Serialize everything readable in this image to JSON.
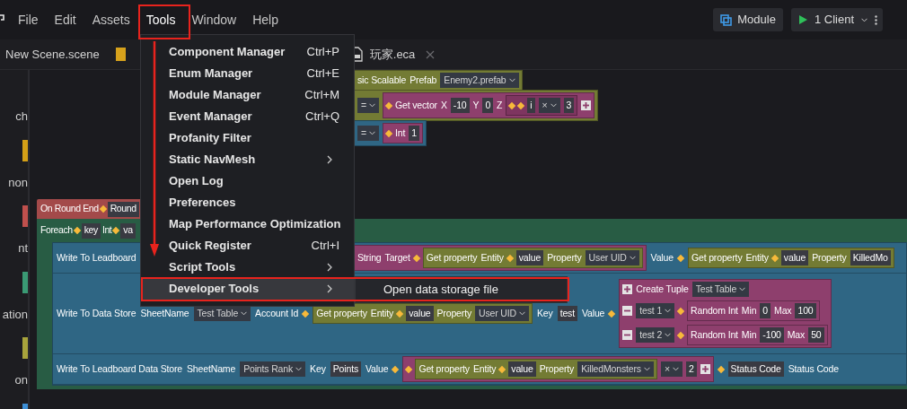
{
  "menubar": {
    "items": [
      {
        "label": "File",
        "selected": false
      },
      {
        "label": "Edit",
        "selected": false
      },
      {
        "label": "Assets",
        "selected": false
      },
      {
        "label": "Tools",
        "selected": true
      },
      {
        "label": "Window",
        "selected": false
      },
      {
        "label": "Help",
        "selected": false
      }
    ]
  },
  "toolbar": {
    "module_button": "Module",
    "run_button": "1 Client"
  },
  "tabs": [
    {
      "kind": "scene",
      "label": "New Scene.scene"
    },
    {
      "kind": "script",
      "label": "玩家.eca",
      "closable": true
    }
  ],
  "sidebar": {
    "items": [
      {
        "label": "ch"
      },
      {
        "color": "#d4a017",
        "label": "non"
      },
      {
        "color": "#c0504d",
        "label": "nt"
      },
      {
        "color": "#3a9a74",
        "label": "ation"
      },
      {
        "color": "#a8a43c",
        "label": "on"
      },
      {
        "color": "#3d8fd6"
      }
    ]
  },
  "canvas": {
    "blocks": [
      {
        "kind": "block",
        "color": "#737b34",
        "tokens": [
          {
            "kind": "text",
            "text": "sic Scalable"
          },
          {
            "kind": "text",
            "text": "Prefab"
          },
          {
            "kind": "dropdown",
            "text": "Enemy2.prefab"
          }
        ]
      },
      {
        "kind": "block",
        "color": "#737b34",
        "tokens": [
          {
            "kind": "dropdown",
            "text": "="
          },
          {
            "kind": "block",
            "color": "#8e3f6d",
            "tokens": [
              {
                "kind": "pin"
              },
              {
                "kind": "text",
                "text": "Get vector"
              },
              {
                "kind": "text",
                "text": "X"
              },
              {
                "kind": "field",
                "text": "-10"
              },
              {
                "kind": "text",
                "text": "Y"
              },
              {
                "kind": "field",
                "text": "0"
              },
              {
                "kind": "text",
                "text": "Z"
              },
              {
                "kind": "block",
                "color": "#7e3560",
                "tokens": [
                  {
                    "kind": "pin"
                  },
                  {
                    "kind": "pin"
                  },
                  {
                    "kind": "field",
                    "text": "i"
                  },
                  {
                    "kind": "dropdown",
                    "text": "×"
                  },
                  {
                    "kind": "field",
                    "text": "3"
                  }
                ]
              },
              {
                "kind": "plus"
              }
            ]
          }
        ]
      },
      {
        "kind": "block",
        "color": "#2f6684",
        "tokens": [
          {
            "kind": "dropdown",
            "text": "="
          },
          {
            "kind": "block",
            "color": "#8e3f6d",
            "tokens": [
              {
                "kind": "pin"
              },
              {
                "kind": "text",
                "text": "Int"
              },
              {
                "kind": "field",
                "text": "1"
              }
            ]
          }
        ]
      }
    ],
    "event": {
      "header": [
        {
          "kind": "text",
          "text": "On Round End"
        },
        {
          "kind": "pin"
        },
        {
          "kind": "field",
          "text": "Round"
        }
      ],
      "loop": [
        {
          "kind": "text",
          "text": "Foreach"
        },
        {
          "kind": "pin"
        },
        {
          "kind": "field",
          "text": "key"
        },
        {
          "kind": "text",
          "text": "Int"
        },
        {
          "kind": "pin"
        },
        {
          "kind": "field",
          "text": "va"
        }
      ],
      "statements": [
        {
          "tokens": [
            {
              "kind": "text",
              "text": "Write To Leadboard"
            }
          ],
          "tokens_right": [
            {
              "kind": "block",
              "color": "#8e3f6d",
              "tokens": [
                {
                  "kind": "text",
                  "text": "String"
                },
                {
                  "kind": "text",
                  "text": "Target"
                },
                {
                  "kind": "pin"
                },
                {
                  "kind": "block",
                  "color": "#737b34",
                  "tokens": [
                    {
                      "kind": "text",
                      "text": "Get property"
                    },
                    {
                      "kind": "text",
                      "text": "Entity"
                    },
                    {
                      "kind": "pin"
                    },
                    {
                      "kind": "field",
                      "text": "value"
                    },
                    {
                      "kind": "text",
                      "text": "Property"
                    },
                    {
                      "kind": "dropdown",
                      "text": "User UID"
                    }
                  ]
                }
              ]
            },
            {
              "kind": "text",
              "text": "Value"
            },
            {
              "kind": "pin"
            },
            {
              "kind": "block",
              "color": "#737b34",
              "tokens": [
                {
                  "kind": "text",
                  "text": "Get property"
                },
                {
                  "kind": "text",
                  "text": "Entity"
                },
                {
                  "kind": "pin"
                },
                {
                  "kind": "field",
                  "text": "value"
                },
                {
                  "kind": "text",
                  "text": "Property"
                },
                {
                  "kind": "field",
                  "text": "KilledMo"
                }
              ]
            }
          ]
        },
        {
          "tokens": [
            {
              "kind": "text",
              "text": "Write To Data Store"
            },
            {
              "kind": "text",
              "text": "SheetName"
            },
            {
              "kind": "dropdown",
              "text": "Test Table"
            },
            {
              "kind": "text",
              "text": "Account Id"
            },
            {
              "kind": "pin"
            },
            {
              "kind": "block",
              "color": "#737b34",
              "tokens": [
                {
                  "kind": "text",
                  "text": "Get property"
                },
                {
                  "kind": "text",
                  "text": "Entity"
                },
                {
                  "kind": "pin"
                },
                {
                  "kind": "field",
                  "text": "value"
                },
                {
                  "kind": "text",
                  "text": "Property"
                },
                {
                  "kind": "dropdown",
                  "text": "User UID"
                }
              ]
            },
            {
              "kind": "text",
              "text": "Key"
            },
            {
              "kind": "field",
              "text": "test"
            },
            {
              "kind": "text",
              "text": "Value"
            },
            {
              "kind": "pin"
            },
            {
              "kind": "block",
              "color": "#8e3f6d",
              "rows": [
                [
                  {
                    "kind": "plus"
                  },
                  {
                    "kind": "text",
                    "text": "Create Tuple"
                  },
                  {
                    "kind": "dropdown",
                    "text": "Test Table"
                  }
                ],
                [
                  {
                    "kind": "minus"
                  },
                  {
                    "kind": "dropdown",
                    "text": "test 1"
                  },
                  {
                    "kind": "pin"
                  },
                  {
                    "kind": "block",
                    "color": "#8e3f6d",
                    "tokens": [
                      {
                        "kind": "text",
                        "text": "Random Int"
                      },
                      {
                        "kind": "text",
                        "text": "Min"
                      },
                      {
                        "kind": "field",
                        "text": "0"
                      },
                      {
                        "kind": "text",
                        "text": "Max"
                      },
                      {
                        "kind": "field",
                        "text": "100"
                      }
                    ]
                  }
                ],
                [
                  {
                    "kind": "minus"
                  },
                  {
                    "kind": "dropdown",
                    "text": "test 2"
                  },
                  {
                    "kind": "pin"
                  },
                  {
                    "kind": "block",
                    "color": "#8e3f6d",
                    "tokens": [
                      {
                        "kind": "text",
                        "text": "Random Int"
                      },
                      {
                        "kind": "text",
                        "text": "Min"
                      },
                      {
                        "kind": "field",
                        "text": "-100"
                      },
                      {
                        "kind": "text",
                        "text": "Max"
                      },
                      {
                        "kind": "field",
                        "text": "50"
                      }
                    ]
                  }
                ]
              ]
            }
          ]
        },
        {
          "tokens": [
            {
              "kind": "text",
              "text": "Write To Leadboard Data Store"
            },
            {
              "kind": "text",
              "text": "SheetName"
            },
            {
              "kind": "dropdown",
              "text": "Points Rank"
            },
            {
              "kind": "text",
              "text": "Key"
            },
            {
              "kind": "field",
              "text": "Points"
            },
            {
              "kind": "text",
              "text": "Value"
            },
            {
              "kind": "pin"
            },
            {
              "kind": "block",
              "color": "#8e3f6d",
              "tokens": [
                {
                  "kind": "pin"
                },
                {
                  "kind": "block",
                  "color": "#737b34",
                  "tokens": [
                    {
                      "kind": "text",
                      "text": "Get property"
                    },
                    {
                      "kind": "text",
                      "text": "Entity"
                    },
                    {
                      "kind": "pin"
                    },
                    {
                      "kind": "field",
                      "text": "value"
                    },
                    {
                      "kind": "text",
                      "text": "Property"
                    },
                    {
                      "kind": "dropdown",
                      "text": "KilledMonsters"
                    }
                  ]
                },
                {
                  "kind": "dropdown",
                  "text": "×"
                },
                {
                  "kind": "field",
                  "text": "2"
                },
                {
                  "kind": "plus"
                }
              ]
            },
            {
              "kind": "pin"
            },
            {
              "kind": "field",
              "text": "Status Code"
            },
            {
              "kind": "text",
              "text": "Status Code"
            }
          ]
        }
      ]
    }
  },
  "menu": {
    "items": [
      {
        "label": "Component Manager",
        "shortcut": "Ctrl+P",
        "submenu": false,
        "selected": false
      },
      {
        "label": "Enum Manager",
        "shortcut": "Ctrl+E",
        "submenu": false,
        "selected": false
      },
      {
        "label": "Module Manager",
        "shortcut": "Ctrl+M",
        "submenu": false,
        "selected": false
      },
      {
        "label": "Event Manager",
        "shortcut": "Ctrl+Q",
        "submenu": false,
        "selected": false
      },
      {
        "label": "Profanity Filter",
        "submenu": false,
        "selected": false
      },
      {
        "label": "Static NavMesh",
        "submenu": true,
        "selected": false
      },
      {
        "label": "Open Log",
        "submenu": false,
        "selected": false
      },
      {
        "label": "Preferences",
        "submenu": false,
        "selected": false
      },
      {
        "label": "Map Performance Optimization",
        "submenu": false,
        "selected": false
      },
      {
        "label": "Quick Register",
        "shortcut": "Ctrl+I",
        "submenu": false,
        "selected": false
      },
      {
        "label": "Script Tools",
        "submenu": true,
        "selected": false
      },
      {
        "label": "Developer Tools",
        "submenu": true,
        "selected": true
      }
    ]
  },
  "submenu": {
    "items": [
      {
        "label": "Open data storage file",
        "selected": false
      }
    ]
  }
}
